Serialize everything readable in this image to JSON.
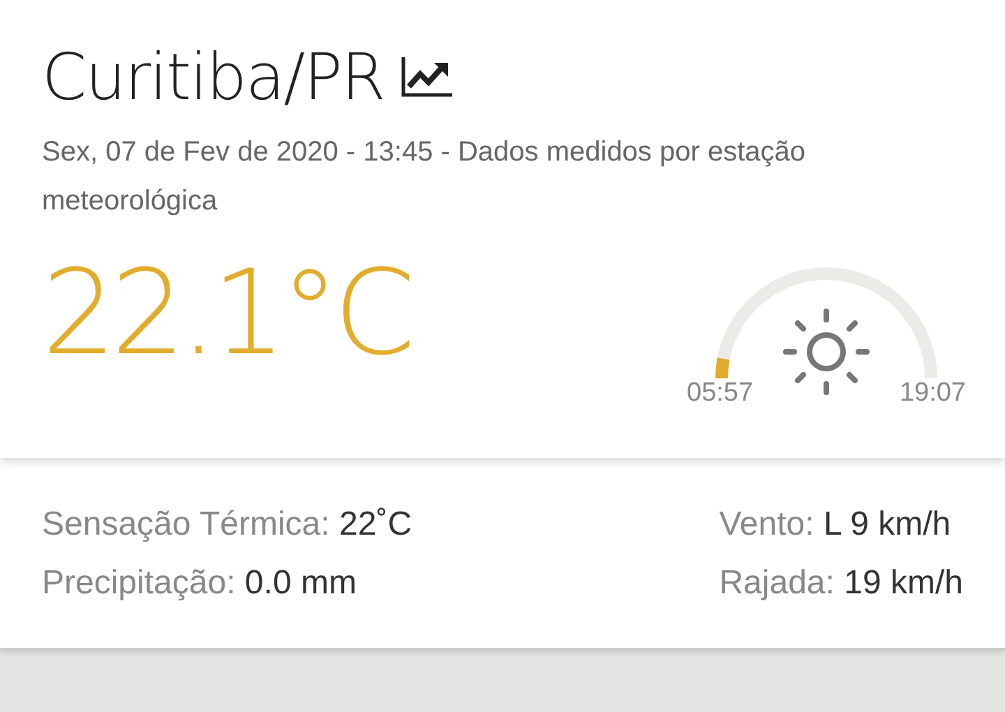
{
  "header": {
    "city": "Curitiba/PR",
    "subtitle": "Sex, 07 de Fev de 2020 - 13:45 - Dados medidos por estação meteorológica"
  },
  "current": {
    "temperature": "22.1°C"
  },
  "sun": {
    "sunrise": "05:57",
    "sunset": "19:07"
  },
  "details": [
    {
      "label": "Sensação Térmica:",
      "value": "22˚C"
    },
    {
      "label": "Vento:",
      "value": "L 9 km/h"
    },
    {
      "label": "Precipitação:",
      "value": "0.0 mm"
    },
    {
      "label": "Rajada:",
      "value": "19 km/h"
    }
  ]
}
